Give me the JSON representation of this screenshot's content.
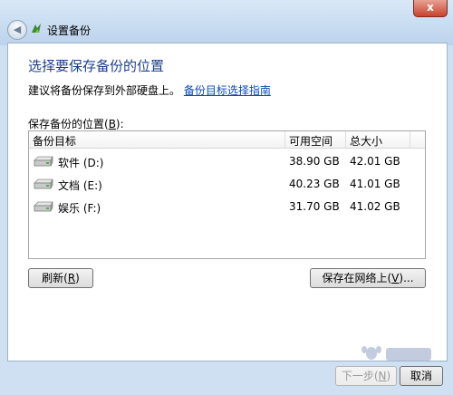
{
  "window": {
    "title": "设置备份",
    "close_label": "x"
  },
  "page": {
    "heading": "选择要保存备份的位置",
    "advice_text": "建议将备份保存到外部硬盘上。",
    "advice_link": "备份目标选择指南",
    "list_label_prefix": "保存备份的位置(",
    "list_label_key": "B",
    "list_label_suffix": "):"
  },
  "table": {
    "columns": [
      "备份目标",
      "可用空间",
      "总大小"
    ],
    "rows": [
      {
        "name": "软件 (D:)",
        "free": "38.90 GB",
        "total": "42.01 GB",
        "icon": "hard-drive-icon"
      },
      {
        "name": "文档 (E:)",
        "free": "40.23 GB",
        "total": "41.01 GB",
        "icon": "hard-drive-icon"
      },
      {
        "name": "娱乐 (F:)",
        "free": "31.70 GB",
        "total": "41.02 GB",
        "icon": "hard-drive-icon"
      }
    ]
  },
  "buttons": {
    "refresh_prefix": "刷新(",
    "refresh_key": "R",
    "refresh_suffix": ")",
    "network_prefix": "保存在网络上(",
    "network_key": "V",
    "network_suffix": ")...",
    "next_prefix": "下一步(",
    "next_key": "N",
    "next_suffix": ")",
    "cancel": "取消"
  },
  "colors": {
    "heading": "#1e3f8a",
    "link": "#0a4bb6",
    "frame": "#cfe0f3"
  }
}
